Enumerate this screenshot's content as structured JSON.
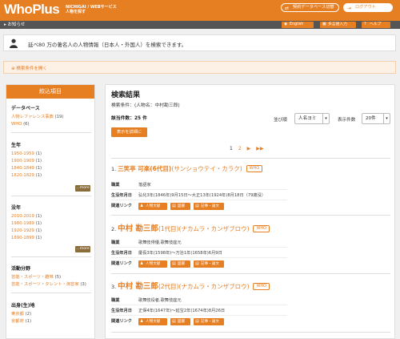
{
  "header": {
    "logo": "WhoPlus",
    "logo_sub1": "NICHIGAI / WEBサービス",
    "logo_sub2": "人物を探す",
    "contract_db_btn": "契約データベース切替",
    "logout_btn": "ログアウト"
  },
  "subbar": {
    "notice": "お知らせ",
    "english": "English",
    "multi_char": "多言語入力",
    "help": "ヘルプ"
  },
  "intro": {
    "text": "延べ80 万の著名人の人物情報（日本人・外国人）を検索できます。"
  },
  "condition_toggle": "検索条件を開く",
  "sidebar": {
    "title": "絞込項目",
    "database": {
      "title": "データベース",
      "items": [
        {
          "label": "人物レファレンス事典",
          "count": "(19)"
        },
        {
          "label": "WHO",
          "count": "(6)"
        }
      ]
    },
    "birth": {
      "title": "生年",
      "items": [
        {
          "label": "1950-1959",
          "count": "(1)"
        },
        {
          "label": "1900-1909",
          "count": "(1)"
        },
        {
          "label": "1840-1849",
          "count": "(1)"
        },
        {
          "label": "1820-1829",
          "count": "(1)"
        }
      ],
      "more": "...more"
    },
    "death": {
      "title": "没年",
      "items": [
        {
          "label": "2010-2019",
          "count": "(1)"
        },
        {
          "label": "1980-1989",
          "count": "(1)"
        },
        {
          "label": "1920-1929",
          "count": "(1)"
        },
        {
          "label": "1890-1899",
          "count": "(1)"
        }
      ],
      "more": "...more"
    },
    "field": {
      "title": "活動分野",
      "items": [
        {
          "label": "芸能・スポーツ・趣味",
          "count": "(5)"
        },
        {
          "label": "芸能・スポーツ・タレント・演芸家",
          "count": "(3)"
        }
      ]
    },
    "origin": {
      "title": "出身(生)地",
      "items": [
        {
          "label": "東京都",
          "count": "(2)"
        },
        {
          "label": "京都府",
          "count": "(1)"
        }
      ]
    }
  },
  "main": {
    "title": "検索結果",
    "condition": "検索条件：(人物名：中村勘三郎)",
    "count": "該当件数：25 件",
    "sort_label": "並び順",
    "sort_value": "人名ヨミ",
    "per_page_label": "表示件数",
    "per_page_value": "20件",
    "detail_button": "表示を詳細に",
    "pager": [
      "1",
      "2",
      "▶",
      "▶▶"
    ],
    "results": [
      {
        "num": "1.",
        "name": "三笑亭 可楽(6代目)",
        "reading": "(サンショウテイ・カラク)",
        "badge": "WHO",
        "job_label": "職業",
        "job": "落語家",
        "life_label": "生没年月日",
        "life": "弘化3年(1846年)9月15日〜大正13年(1924年)8月18日（79歳没）",
        "link_label": "関連リンク",
        "links": [
          "人物文献",
          "図書",
          "記事・論文"
        ]
      },
      {
        "num": "2.",
        "name": "中村 勘三郎",
        "reading": "(1代目)(ナカムラ・カンザブロウ)",
        "badge": "WHO",
        "job_label": "職業",
        "job": "歌舞伎俳優,歌舞伎座元",
        "life_label": "生没年月日",
        "life": "慶長3年(1598年)〜万治1年(1658年)6月9日",
        "link_label": "関連リンク",
        "links": [
          "人物文献",
          "図書",
          "記事・論文"
        ]
      },
      {
        "num": "3.",
        "name": "中村 勘三郎",
        "reading": "(2代目)(ナカムラ・カンザブロウ)",
        "badge": "WHO",
        "job_label": "職業",
        "job": "歌舞伎役者,歌舞伎座元",
        "life_label": "生没年月日",
        "life": "正保4年(1647年)〜延宝2年(1674年)8月26日",
        "link_label": "関連リンク",
        "links": [
          "人物文献",
          "図書",
          "記事・論文"
        ]
      }
    ]
  }
}
